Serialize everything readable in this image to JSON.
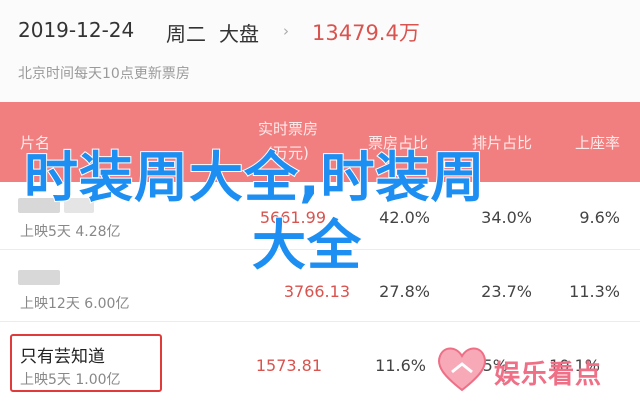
{
  "top": {
    "date": "2019-12-24",
    "weekday": "周二",
    "market_label": "大盘",
    "chevron": "›",
    "total_box_office": "13479.4万",
    "subtitle": "北京时间每天10点更新票房"
  },
  "table": {
    "headers": {
      "film": "片名",
      "realtime_box": "实时票房",
      "realtime_unit": "(万元)",
      "box_share": "票房占比",
      "schedule_share": "排片占比",
      "seat_rate": "上座率"
    },
    "rows": [
      {
        "name": "",
        "release": "上映5天",
        "total": "4.28亿",
        "box": "5661.99",
        "box_share": "42.0%",
        "schedule_share": "34.0%",
        "seat_rate": "9.6%"
      },
      {
        "name": "",
        "release": "上映12天",
        "total": "6.00亿",
        "box": "3766.13",
        "box_share": "27.8%",
        "schedule_share": "23.7%",
        "seat_rate": "11.3%"
      },
      {
        "name": "只有芸知道",
        "release": "上映5天",
        "total": "1.00亿",
        "box": "1573.81",
        "box_share": "11.6%",
        "schedule_share": "13.5%",
        "seat_rate": "10.1%"
      }
    ]
  },
  "overlay": {
    "line1": "时装周大全,时装周",
    "line2": "大全"
  },
  "watermark": {
    "text": "娱乐看点",
    "icon": "heart-logo-icon",
    "color": "#ee6f86"
  },
  "colors": {
    "header_bg": "#f17f80",
    "accent_red": "#d9534f",
    "overlay_blue": "#1d8ef2"
  }
}
